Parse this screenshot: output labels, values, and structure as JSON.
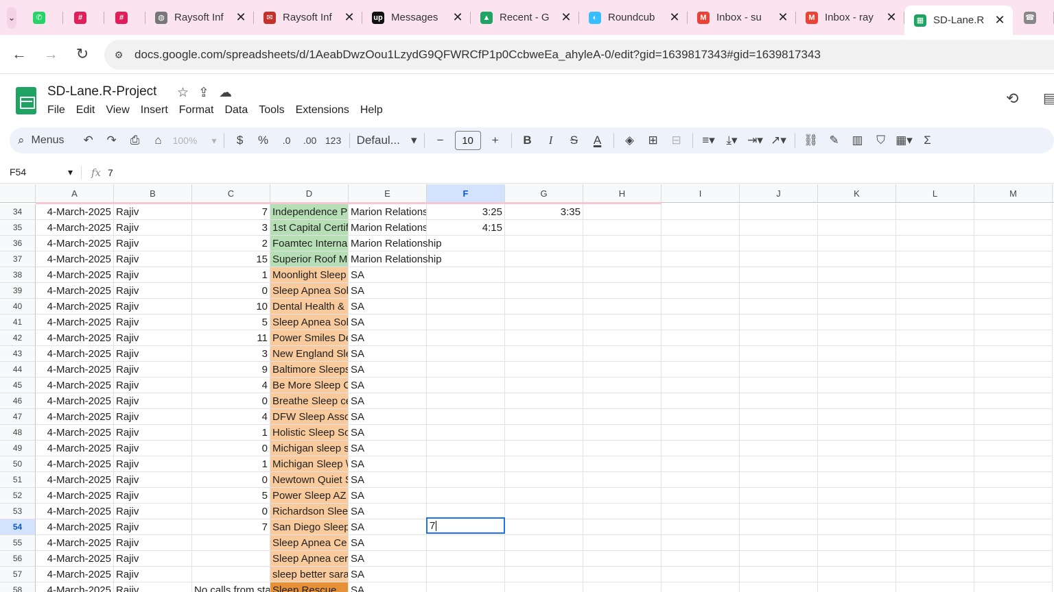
{
  "tabs": [
    {
      "title": "",
      "icon": "whatsapp-icon",
      "color": "#25d366"
    },
    {
      "title": "",
      "icon": "slack-icon",
      "color": "#e01e5a"
    },
    {
      "title": "",
      "icon": "slack-icon",
      "color": "#e01e5a"
    },
    {
      "title": "Raysoft Inf",
      "icon": "globe-icon",
      "color": "#777777"
    },
    {
      "title": "Raysoft Inf",
      "icon": "mail-icon",
      "color": "#c4302b"
    },
    {
      "title": "Messages",
      "icon": "upwork-icon",
      "color": "#111111"
    },
    {
      "title": "Recent - G",
      "icon": "drive-icon",
      "color": "#1fa463"
    },
    {
      "title": "Roundcub",
      "icon": "roundcube-icon",
      "color": "#37beff"
    },
    {
      "title": "Inbox - su",
      "icon": "gmail-icon",
      "color": "#ea4335"
    },
    {
      "title": "Inbox - ray",
      "icon": "gmail-icon",
      "color": "#ea4335"
    },
    {
      "title": "SD-Lane.R",
      "icon": "sheets-icon",
      "color": "#1ea362",
      "active": true
    },
    {
      "title": "",
      "icon": "phone-icon",
      "color": "#888888"
    }
  ],
  "address": {
    "url": "docs.google.com/spreadsheets/d/1AeabDwzOou1LzydG9QFWRCfP1p0CcbweEa_ahyleA-0/edit?gid=1639817343#gid=1639817343"
  },
  "doc": {
    "title": "SD-Lane.R-Project"
  },
  "menu": [
    "File",
    "Edit",
    "View",
    "Insert",
    "Format",
    "Data",
    "Tools",
    "Extensions",
    "Help"
  ],
  "toolbar": {
    "search": "Menus",
    "zoom": "100%",
    "currency": "$",
    "percent": "%",
    "dec_less": ".0",
    "dec_more": ".00",
    "number_format": "123",
    "font": "Defaul...",
    "font_size": "10",
    "bold": "B",
    "italic": "I",
    "strike": "S",
    "text_color": "A"
  },
  "formula": {
    "cell": "F54",
    "value": "7"
  },
  "columns": [
    "A",
    "B",
    "C",
    "D",
    "E",
    "F",
    "G",
    "H",
    "I",
    "J",
    "K",
    "L",
    "M"
  ],
  "selected_column": "F",
  "selected_row": "54",
  "rows": [
    {
      "n": "34",
      "a": "4-March-2025",
      "b": "Rajiv",
      "c": "7",
      "d": "Independence P",
      "e": "Marion Relations",
      "f": "3:25",
      "g": "3:35",
      "dc": "green"
    },
    {
      "n": "35",
      "a": "4-March-2025",
      "b": "Rajiv",
      "c": "3",
      "d": "1st Capital Certif",
      "e": "Marion Relations",
      "f": "4:15",
      "g": "",
      "dc": "green"
    },
    {
      "n": "36",
      "a": "4-March-2025",
      "b": "Rajiv",
      "c": "2",
      "d": "Foamtec Interna",
      "e": "Marion Relationship",
      "f": "",
      "g": "",
      "dc": "green"
    },
    {
      "n": "37",
      "a": "4-March-2025",
      "b": "Rajiv",
      "c": "15",
      "d": "Superior Roof M",
      "e": "Marion Relationship",
      "f": "",
      "g": "",
      "dc": "green"
    },
    {
      "n": "38",
      "a": "4-March-2025",
      "b": "Rajiv",
      "c": "1",
      "d": "Moonlight Sleep",
      "e": "SA",
      "f": "",
      "g": "",
      "dc": "orange"
    },
    {
      "n": "39",
      "a": "4-March-2025",
      "b": "Rajiv",
      "c": "0",
      "d": "Sleep Apnea Sol",
      "e": "SA",
      "f": "",
      "g": "",
      "dc": "orange"
    },
    {
      "n": "40",
      "a": "4-March-2025",
      "b": "Rajiv",
      "c": "10",
      "d": "Dental Health & ",
      "e": "SA",
      "f": "",
      "g": "",
      "dc": "orange"
    },
    {
      "n": "41",
      "a": "4-March-2025",
      "b": "Rajiv",
      "c": "5",
      "d": "Sleep Apnea Sol",
      "e": "SA",
      "f": "",
      "g": "",
      "dc": "orange"
    },
    {
      "n": "42",
      "a": "4-March-2025",
      "b": "Rajiv",
      "c": "11",
      "d": "Power Smiles De",
      "e": "SA",
      "f": "",
      "g": "",
      "dc": "orange"
    },
    {
      "n": "43",
      "a": "4-March-2025",
      "b": "Rajiv",
      "c": "3",
      "d": "New England Sle",
      "e": "SA",
      "f": "",
      "g": "",
      "dc": "orange"
    },
    {
      "n": "44",
      "a": "4-March-2025",
      "b": "Rajiv",
      "c": "9",
      "d": "Baltimore Sleeps",
      "e": "SA",
      "f": "",
      "g": "",
      "dc": "orange"
    },
    {
      "n": "45",
      "a": "4-March-2025",
      "b": "Rajiv",
      "c": "4",
      "d": "Be More Sleep C",
      "e": "SA",
      "f": "",
      "g": "",
      "dc": "orange"
    },
    {
      "n": "46",
      "a": "4-March-2025",
      "b": "Rajiv",
      "c": "0",
      "d": "Breathe Sleep ce",
      "e": "SA",
      "f": "",
      "g": "",
      "dc": "orange"
    },
    {
      "n": "47",
      "a": "4-March-2025",
      "b": "Rajiv",
      "c": "4",
      "d": "DFW Sleep Asso",
      "e": "SA",
      "f": "",
      "g": "",
      "dc": "orange"
    },
    {
      "n": "48",
      "a": "4-March-2025",
      "b": "Rajiv",
      "c": "1",
      "d": "Holistic Sleep So",
      "e": "SA",
      "f": "",
      "g": "",
      "dc": "orange"
    },
    {
      "n": "49",
      "a": "4-March-2025",
      "b": "Rajiv",
      "c": "0",
      "d": "Michigan sleep s",
      "e": "SA",
      "f": "",
      "g": "",
      "dc": "orange"
    },
    {
      "n": "50",
      "a": "4-March-2025",
      "b": "Rajiv",
      "c": "1",
      "d": "Michigan Sleep \\",
      "e": "SA",
      "f": "",
      "g": "",
      "dc": "orange"
    },
    {
      "n": "51",
      "a": "4-March-2025",
      "b": "Rajiv",
      "c": "0",
      "d": "Newtown Quiet S",
      "e": "SA",
      "f": "",
      "g": "",
      "dc": "orange"
    },
    {
      "n": "52",
      "a": "4-March-2025",
      "b": "Rajiv",
      "c": "5",
      "d": "Power Sleep AZ",
      "e": "SA",
      "f": "",
      "g": "",
      "dc": "orange"
    },
    {
      "n": "53",
      "a": "4-March-2025",
      "b": "Rajiv",
      "c": "0",
      "d": "Richardson Slee",
      "e": "SA",
      "f": "",
      "g": "",
      "dc": "orange"
    },
    {
      "n": "54",
      "a": "4-March-2025",
      "b": "Rajiv",
      "c": "7",
      "d": "San Diego Sleep",
      "e": "SA",
      "f": "",
      "g": "",
      "dc": "orange"
    },
    {
      "n": "55",
      "a": "4-March-2025",
      "b": "Rajiv",
      "c": "",
      "d": "Sleep Apnea Ce",
      "e": "SA",
      "f": "",
      "g": "",
      "dc": "orange"
    },
    {
      "n": "56",
      "a": "4-March-2025",
      "b": "Rajiv",
      "c": "",
      "d": "Sleep Apnea cer",
      "e": "SA",
      "f": "",
      "g": "",
      "dc": "orange"
    },
    {
      "n": "57",
      "a": "4-March-2025",
      "b": "Rajiv",
      "c": "",
      "d": "sleep better sara",
      "e": "SA",
      "f": "",
      "g": "",
      "dc": "orange"
    },
    {
      "n": "58",
      "a": "4-March-2025",
      "b": "Rajiv",
      "c": "No calls from sta",
      "d": "Sleep Rescue",
      "e": "SA",
      "f": "",
      "g": "",
      "dc": "darkorange"
    }
  ],
  "editor": {
    "value": "7"
  },
  "colors": {
    "green": "#b7dfb5",
    "orange": "#f9cb9c",
    "darkorange": "#e69138",
    "selection": "#1a73e8",
    "tabbar": "#fbe4f0"
  }
}
